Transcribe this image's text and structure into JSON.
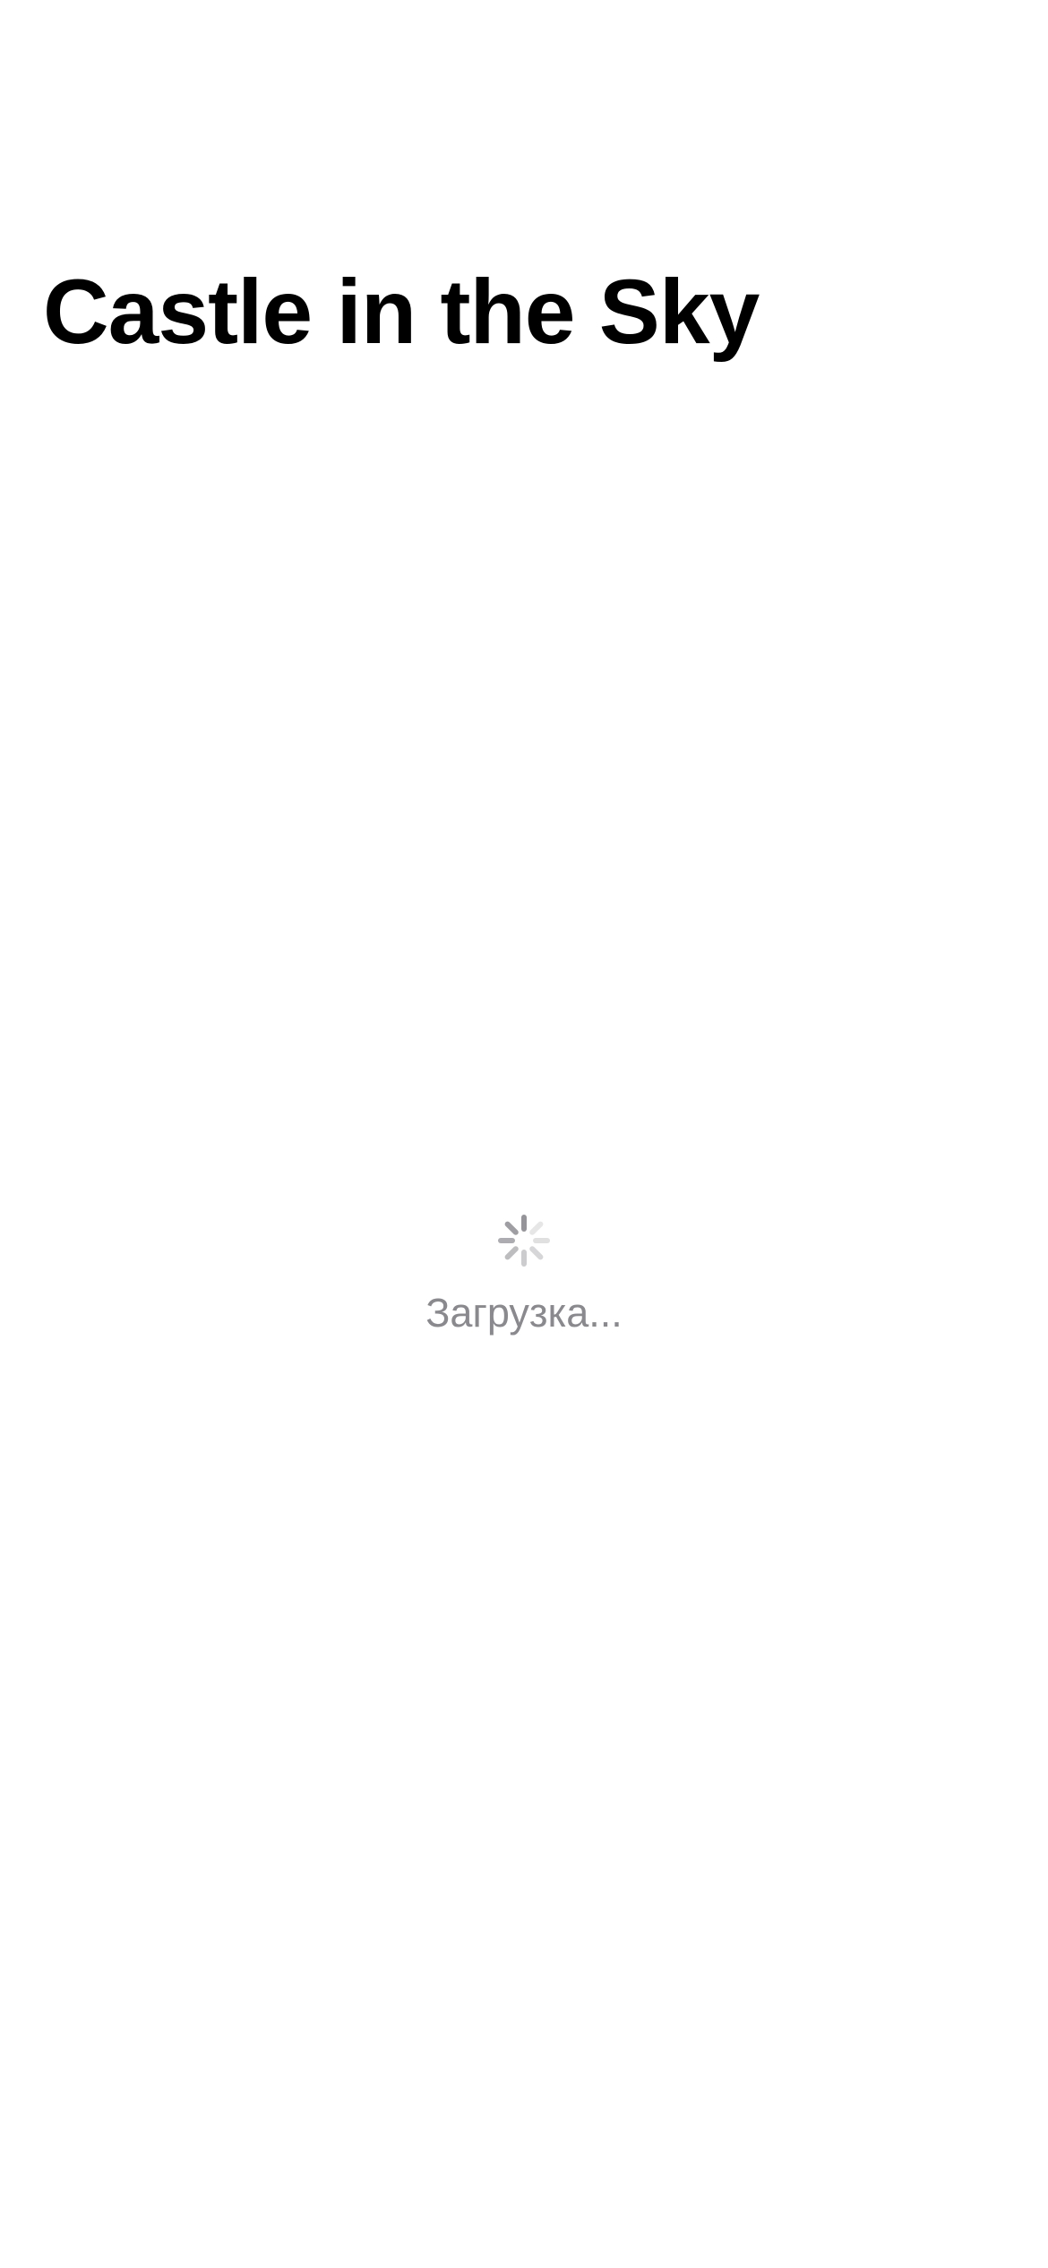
{
  "navigation": {
    "large_title": "Castle in the Sky"
  },
  "loading": {
    "indicator_icon": "activity-indicator-icon",
    "label": "Загрузка..."
  },
  "colors": {
    "background": "#ffffff",
    "title": "#000000",
    "loading_text": "#8a8a8e",
    "spinner": "#8e8e93"
  }
}
